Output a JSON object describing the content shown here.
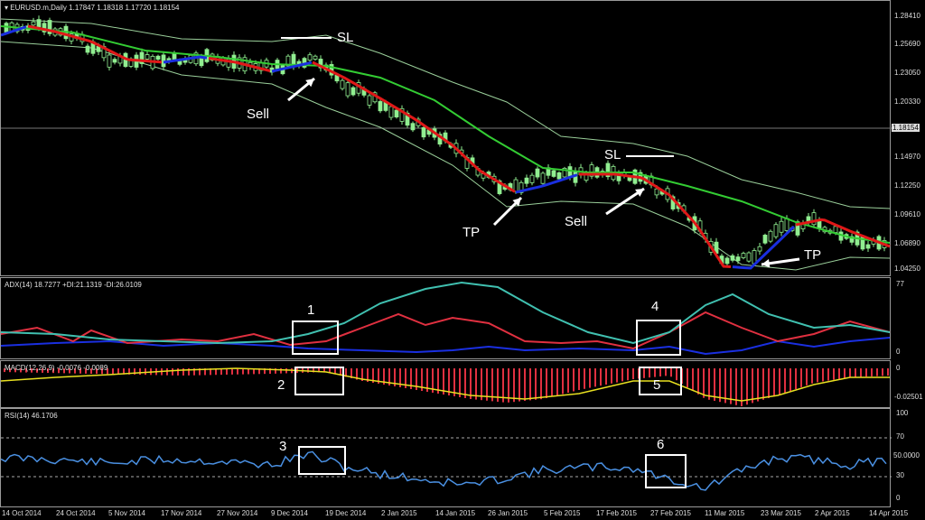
{
  "main": {
    "title": "EURUSD.m,Daily",
    "ohlc": "1.17847 1.18318 1.17720 1.18154",
    "price_scale": [
      "1.28410",
      "1.25690",
      "1.23050",
      "1.20330",
      "1.18154",
      "1.14970",
      "1.12250",
      "1.09610",
      "1.06890",
      "1.04250"
    ],
    "current_price": "1.18154",
    "annotations": {
      "sl1": "SL",
      "sell1": "Sell",
      "tp1": "TP",
      "sl2": "SL",
      "sell2": "Sell",
      "tp2": "TP"
    }
  },
  "adx": {
    "title": "ADX(14) 18.7277 +DI:21.1319 -DI:26.0109",
    "scale": [
      "77",
      "0"
    ],
    "box_labels": [
      "1",
      "4"
    ]
  },
  "macd": {
    "title": "MACD(12,26,9) -0.0076 -0.0089",
    "scale": [
      "0",
      "-0.02501"
    ],
    "box_labels": [
      "2",
      "5"
    ]
  },
  "rsi": {
    "title": "RSI(14) 46.1706",
    "scale": [
      "100",
      "70",
      "50.0000",
      "30",
      "0"
    ],
    "box_labels": [
      "3",
      "6"
    ]
  },
  "time_axis": [
    "14 Oct 2014",
    "24 Oct 2014",
    "5 Nov 2014",
    "17 Nov 2014",
    "27 Nov 2014",
    "9 Dec 2014",
    "19 Dec 2014",
    "2 Jan 2015",
    "14 Jan 2015",
    "26 Jan 2015",
    "5 Feb 2015",
    "17 Feb 2015",
    "27 Feb 2015",
    "11 Mar 2015",
    "23 Mar 2015",
    "2 Apr 2015",
    "14 Apr 2015"
  ],
  "colors": {
    "background": "#000000",
    "bull_candle": "#90ee90",
    "bear_candle": "#90ee90",
    "ma_down": "#e01818",
    "ma_up": "#1a2fe0",
    "ma_slow": "#33cc33",
    "envelope": "#9acf9a",
    "adx_main": "#40c0b0",
    "di_plus": "#1a2fe0",
    "di_minus": "#e03040",
    "macd_hist": "#e03040",
    "macd_signal": "#e8e020",
    "rsi": "#4a90e2"
  }
}
